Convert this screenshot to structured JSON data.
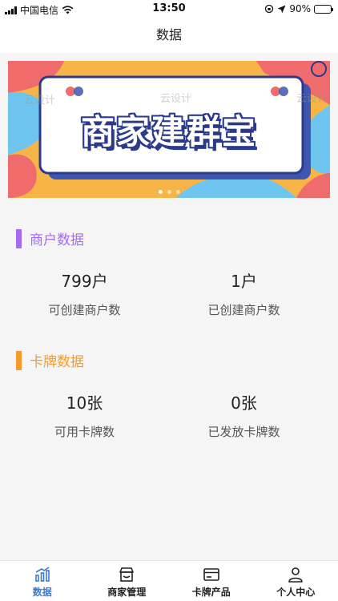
{
  "status_bar": {
    "carrier": "中国电信",
    "time": "13:50",
    "battery": "90%",
    "battery_level": 0.9
  },
  "header": {
    "title": "数据"
  },
  "banner": {
    "title": "商家建群宝",
    "watermarks": [
      "云设计",
      "云设计",
      "云设计"
    ],
    "page_count": 3,
    "active_page": 1
  },
  "merchant_section": {
    "title": "商户数据",
    "accent_color": "#a56bf0",
    "stats": [
      {
        "value": "799户",
        "label": "可创建商户数"
      },
      {
        "value": "1户",
        "label": "已创建商户数"
      }
    ]
  },
  "card_section": {
    "title": "卡牌数据",
    "accent_color": "#f59a2c",
    "stats": [
      {
        "value": "10张",
        "label": "可用卡牌数"
      },
      {
        "value": "0张",
        "label": "已发放卡牌数"
      }
    ]
  },
  "tab_bar": {
    "tabs": [
      {
        "label": "数据",
        "icon": "chart-icon",
        "active": true
      },
      {
        "label": "商家管理",
        "icon": "store-icon",
        "active": false
      },
      {
        "label": "卡牌产品",
        "icon": "card-icon",
        "active": false
      },
      {
        "label": "个人中心",
        "icon": "user-icon",
        "active": false
      }
    ],
    "active_color": "#3a7bd5"
  }
}
